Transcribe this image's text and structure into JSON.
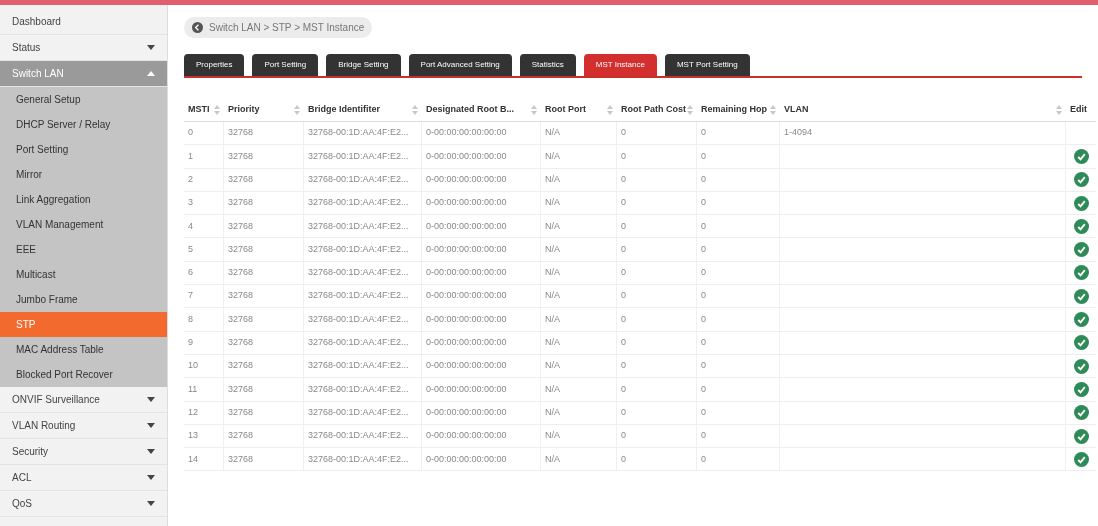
{
  "sidebar": {
    "items": [
      {
        "label": "Dashboard",
        "kind": "link"
      },
      {
        "label": "Status",
        "kind": "menu",
        "expanded": false
      },
      {
        "label": "Switch LAN",
        "kind": "menu",
        "expanded": true,
        "children": [
          {
            "label": "General Setup",
            "selected": false
          },
          {
            "label": "DHCP Server / Relay",
            "selected": false
          },
          {
            "label": "Port Setting",
            "selected": false
          },
          {
            "label": "Mirror",
            "selected": false
          },
          {
            "label": "Link Aggregation",
            "selected": false
          },
          {
            "label": "VLAN Management",
            "selected": false
          },
          {
            "label": "EEE",
            "selected": false
          },
          {
            "label": "Multicast",
            "selected": false
          },
          {
            "label": "Jumbo Frame",
            "selected": false
          },
          {
            "label": "STP",
            "selected": true
          },
          {
            "label": "MAC Address Table",
            "selected": false
          },
          {
            "label": "Blocked Port Recover",
            "selected": false
          }
        ]
      },
      {
        "label": "ONVIF Surveillance",
        "kind": "menu",
        "expanded": false
      },
      {
        "label": "VLAN Routing",
        "kind": "menu",
        "expanded": false
      },
      {
        "label": "Security",
        "kind": "menu",
        "expanded": false
      },
      {
        "label": "ACL",
        "kind": "menu",
        "expanded": false
      },
      {
        "label": "QoS",
        "kind": "menu",
        "expanded": false
      }
    ]
  },
  "breadcrumb": "Switch LAN > STP > MST Instance",
  "tabs": [
    {
      "label": "Properties",
      "selected": false
    },
    {
      "label": "Port Setting",
      "selected": false
    },
    {
      "label": "Bridge Setting",
      "selected": false
    },
    {
      "label": "Port Advanced Setting",
      "selected": false
    },
    {
      "label": "Statistics",
      "selected": false
    },
    {
      "label": "MST Instance",
      "selected": true
    },
    {
      "label": "MST Port Setting",
      "selected": false
    }
  ],
  "table": {
    "columns": [
      {
        "label": "MSTI",
        "sortable": true
      },
      {
        "label": "Priority",
        "sortable": true
      },
      {
        "label": "Bridge Identifiter",
        "sortable": true
      },
      {
        "label": "Designated Root B...",
        "sortable": true
      },
      {
        "label": "Root Port",
        "sortable": true
      },
      {
        "label": "Root Path Cost",
        "sortable": true
      },
      {
        "label": "Remaining Hop",
        "sortable": true
      },
      {
        "label": "VLAN",
        "sortable": true
      },
      {
        "label": "Edit",
        "sortable": false
      }
    ],
    "rows": [
      {
        "cells": [
          "0",
          "32768",
          "32768-00:1D:AA:4F:E2...",
          "0-00:00:00:00:00:00",
          "N/A",
          "0",
          "0",
          "1-4094"
        ],
        "editable": false
      },
      {
        "cells": [
          "1",
          "32768",
          "32768-00:1D:AA:4F:E2...",
          "0-00:00:00:00:00:00",
          "N/A",
          "0",
          "0",
          ""
        ],
        "editable": true
      },
      {
        "cells": [
          "2",
          "32768",
          "32768-00:1D:AA:4F:E2...",
          "0-00:00:00:00:00:00",
          "N/A",
          "0",
          "0",
          ""
        ],
        "editable": true
      },
      {
        "cells": [
          "3",
          "32768",
          "32768-00:1D:AA:4F:E2...",
          "0-00:00:00:00:00:00",
          "N/A",
          "0",
          "0",
          ""
        ],
        "editable": true
      },
      {
        "cells": [
          "4",
          "32768",
          "32768-00:1D:AA:4F:E2...",
          "0-00:00:00:00:00:00",
          "N/A",
          "0",
          "0",
          ""
        ],
        "editable": true
      },
      {
        "cells": [
          "5",
          "32768",
          "32768-00:1D:AA:4F:E2...",
          "0-00:00:00:00:00:00",
          "N/A",
          "0",
          "0",
          ""
        ],
        "editable": true
      },
      {
        "cells": [
          "6",
          "32768",
          "32768-00:1D:AA:4F:E2...",
          "0-00:00:00:00:00:00",
          "N/A",
          "0",
          "0",
          ""
        ],
        "editable": true
      },
      {
        "cells": [
          "7",
          "32768",
          "32768-00:1D:AA:4F:E2...",
          "0-00:00:00:00:00:00",
          "N/A",
          "0",
          "0",
          ""
        ],
        "editable": true
      },
      {
        "cells": [
          "8",
          "32768",
          "32768-00:1D:AA:4F:E2...",
          "0-00:00:00:00:00:00",
          "N/A",
          "0",
          "0",
          ""
        ],
        "editable": true
      },
      {
        "cells": [
          "9",
          "32768",
          "32768-00:1D:AA:4F:E2...",
          "0-00:00:00:00:00:00",
          "N/A",
          "0",
          "0",
          ""
        ],
        "editable": true
      },
      {
        "cells": [
          "10",
          "32768",
          "32768-00:1D:AA:4F:E2...",
          "0-00:00:00:00:00:00",
          "N/A",
          "0",
          "0",
          ""
        ],
        "editable": true
      },
      {
        "cells": [
          "11",
          "32768",
          "32768-00:1D:AA:4F:E2...",
          "0-00:00:00:00:00:00",
          "N/A",
          "0",
          "0",
          ""
        ],
        "editable": true
      },
      {
        "cells": [
          "12",
          "32768",
          "32768-00:1D:AA:4F:E2...",
          "0-00:00:00:00:00:00",
          "N/A",
          "0",
          "0",
          ""
        ],
        "editable": true
      },
      {
        "cells": [
          "13",
          "32768",
          "32768-00:1D:AA:4F:E2...",
          "0-00:00:00:00:00:00",
          "N/A",
          "0",
          "0",
          ""
        ],
        "editable": true
      },
      {
        "cells": [
          "14",
          "32768",
          "32768-00:1D:AA:4F:E2...",
          "0-00:00:00:00:00:00",
          "N/A",
          "0",
          "0",
          ""
        ],
        "editable": true
      }
    ]
  }
}
